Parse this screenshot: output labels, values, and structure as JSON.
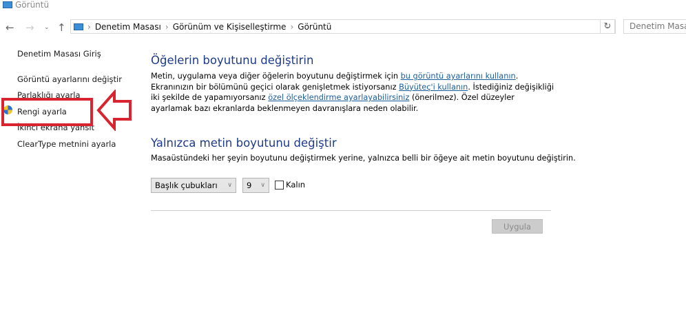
{
  "window": {
    "title": "Görüntü"
  },
  "address": {
    "crumbs": [
      "Denetim Masası",
      "Görünüm ve Kişiselleştirme",
      "Görüntü"
    ],
    "search_placeholder": "Denetim Masası'nda Ara"
  },
  "sidebar": {
    "items": [
      {
        "label": "Denetim Masası Giriş"
      },
      {
        "label": "Görüntü ayarlarını değiştir"
      },
      {
        "label": "Parlaklığı ayarla"
      },
      {
        "label": "Rengi ayarla"
      },
      {
        "label": "İkinci ekrana yansıt"
      },
      {
        "label": "ClearType metnini ayarla"
      }
    ]
  },
  "main": {
    "section1": {
      "title": "Öğelerin boyutunu değiştirin",
      "t1": "Metin, uygulama veya diğer öğelerin boyutunu değiştirmek için ",
      "l1": "bu görüntü ayarlarını kullanın",
      "t2": ". Ekranınızın bir bölümünü geçici olarak genişletmek istiyorsanız ",
      "l2": "Büyüteç'i kullanın",
      "t3": ". İstediğiniz değişikliği iki şekilde de yapamıyorsanız ",
      "l3": "özel ölçeklendirme ayarlayabilirsiniz",
      "t4": " (önerilmez). Özel düzeyler ayarlamak bazı ekranlarda beklenmeyen davranışlara neden olabilir."
    },
    "section2": {
      "title": "Yalnızca metin boyutunu değiştir",
      "desc": "Masaüstündeki her şeyin boyutunu değiştirmek yerine, yalnızca belli bir öğeye ait metin boyutunu değiştirin.",
      "item_select": "Başlık çubukları",
      "size_select": "9",
      "bold_label": "Kalın",
      "bold_checked": false,
      "apply": "Uygula"
    }
  },
  "annotation": {
    "color": "#d9232e"
  }
}
